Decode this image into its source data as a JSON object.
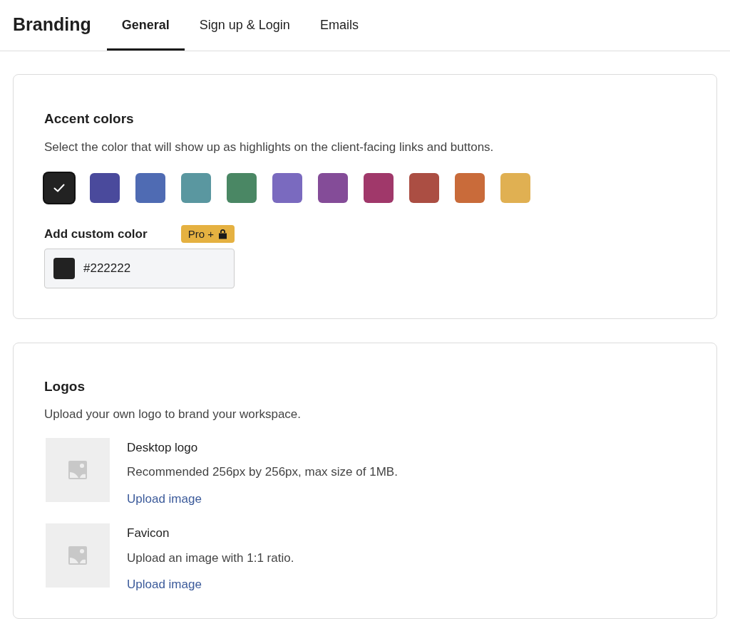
{
  "header": {
    "title": "Branding"
  },
  "tabs": [
    {
      "label": "General",
      "selected": true
    },
    {
      "label": "Sign up & Login",
      "selected": false
    },
    {
      "label": "Emails",
      "selected": false
    }
  ],
  "accent_colors": {
    "title": "Accent colors",
    "description": "Select the color that will show up as highlights on the client-facing links and buttons.",
    "swatches": [
      {
        "color": "#222222",
        "selected": true
      },
      {
        "color": "#4a4a9c",
        "selected": false
      },
      {
        "color": "#4f6bb3",
        "selected": false
      },
      {
        "color": "#5a97a0",
        "selected": false
      },
      {
        "color": "#4a8764",
        "selected": false
      },
      {
        "color": "#7a6abf",
        "selected": false
      },
      {
        "color": "#844c98",
        "selected": false
      },
      {
        "color": "#a0386a",
        "selected": false
      },
      {
        "color": "#ab4e43",
        "selected": false
      },
      {
        "color": "#c96b3a",
        "selected": false
      },
      {
        "color": "#e0b052",
        "selected": false
      }
    ],
    "custom_color": {
      "label": "Add custom color",
      "badge": "Pro +",
      "value": "#222222"
    }
  },
  "logos": {
    "title": "Logos",
    "description": "Upload your own logo to brand your workspace.",
    "items": [
      {
        "name": "Desktop logo",
        "description": "Recommended 256px by 256px, max size of 1MB.",
        "action": "Upload image"
      },
      {
        "name": "Favicon",
        "description": "Upload an image with 1:1 ratio.",
        "action": "Upload image"
      }
    ]
  }
}
